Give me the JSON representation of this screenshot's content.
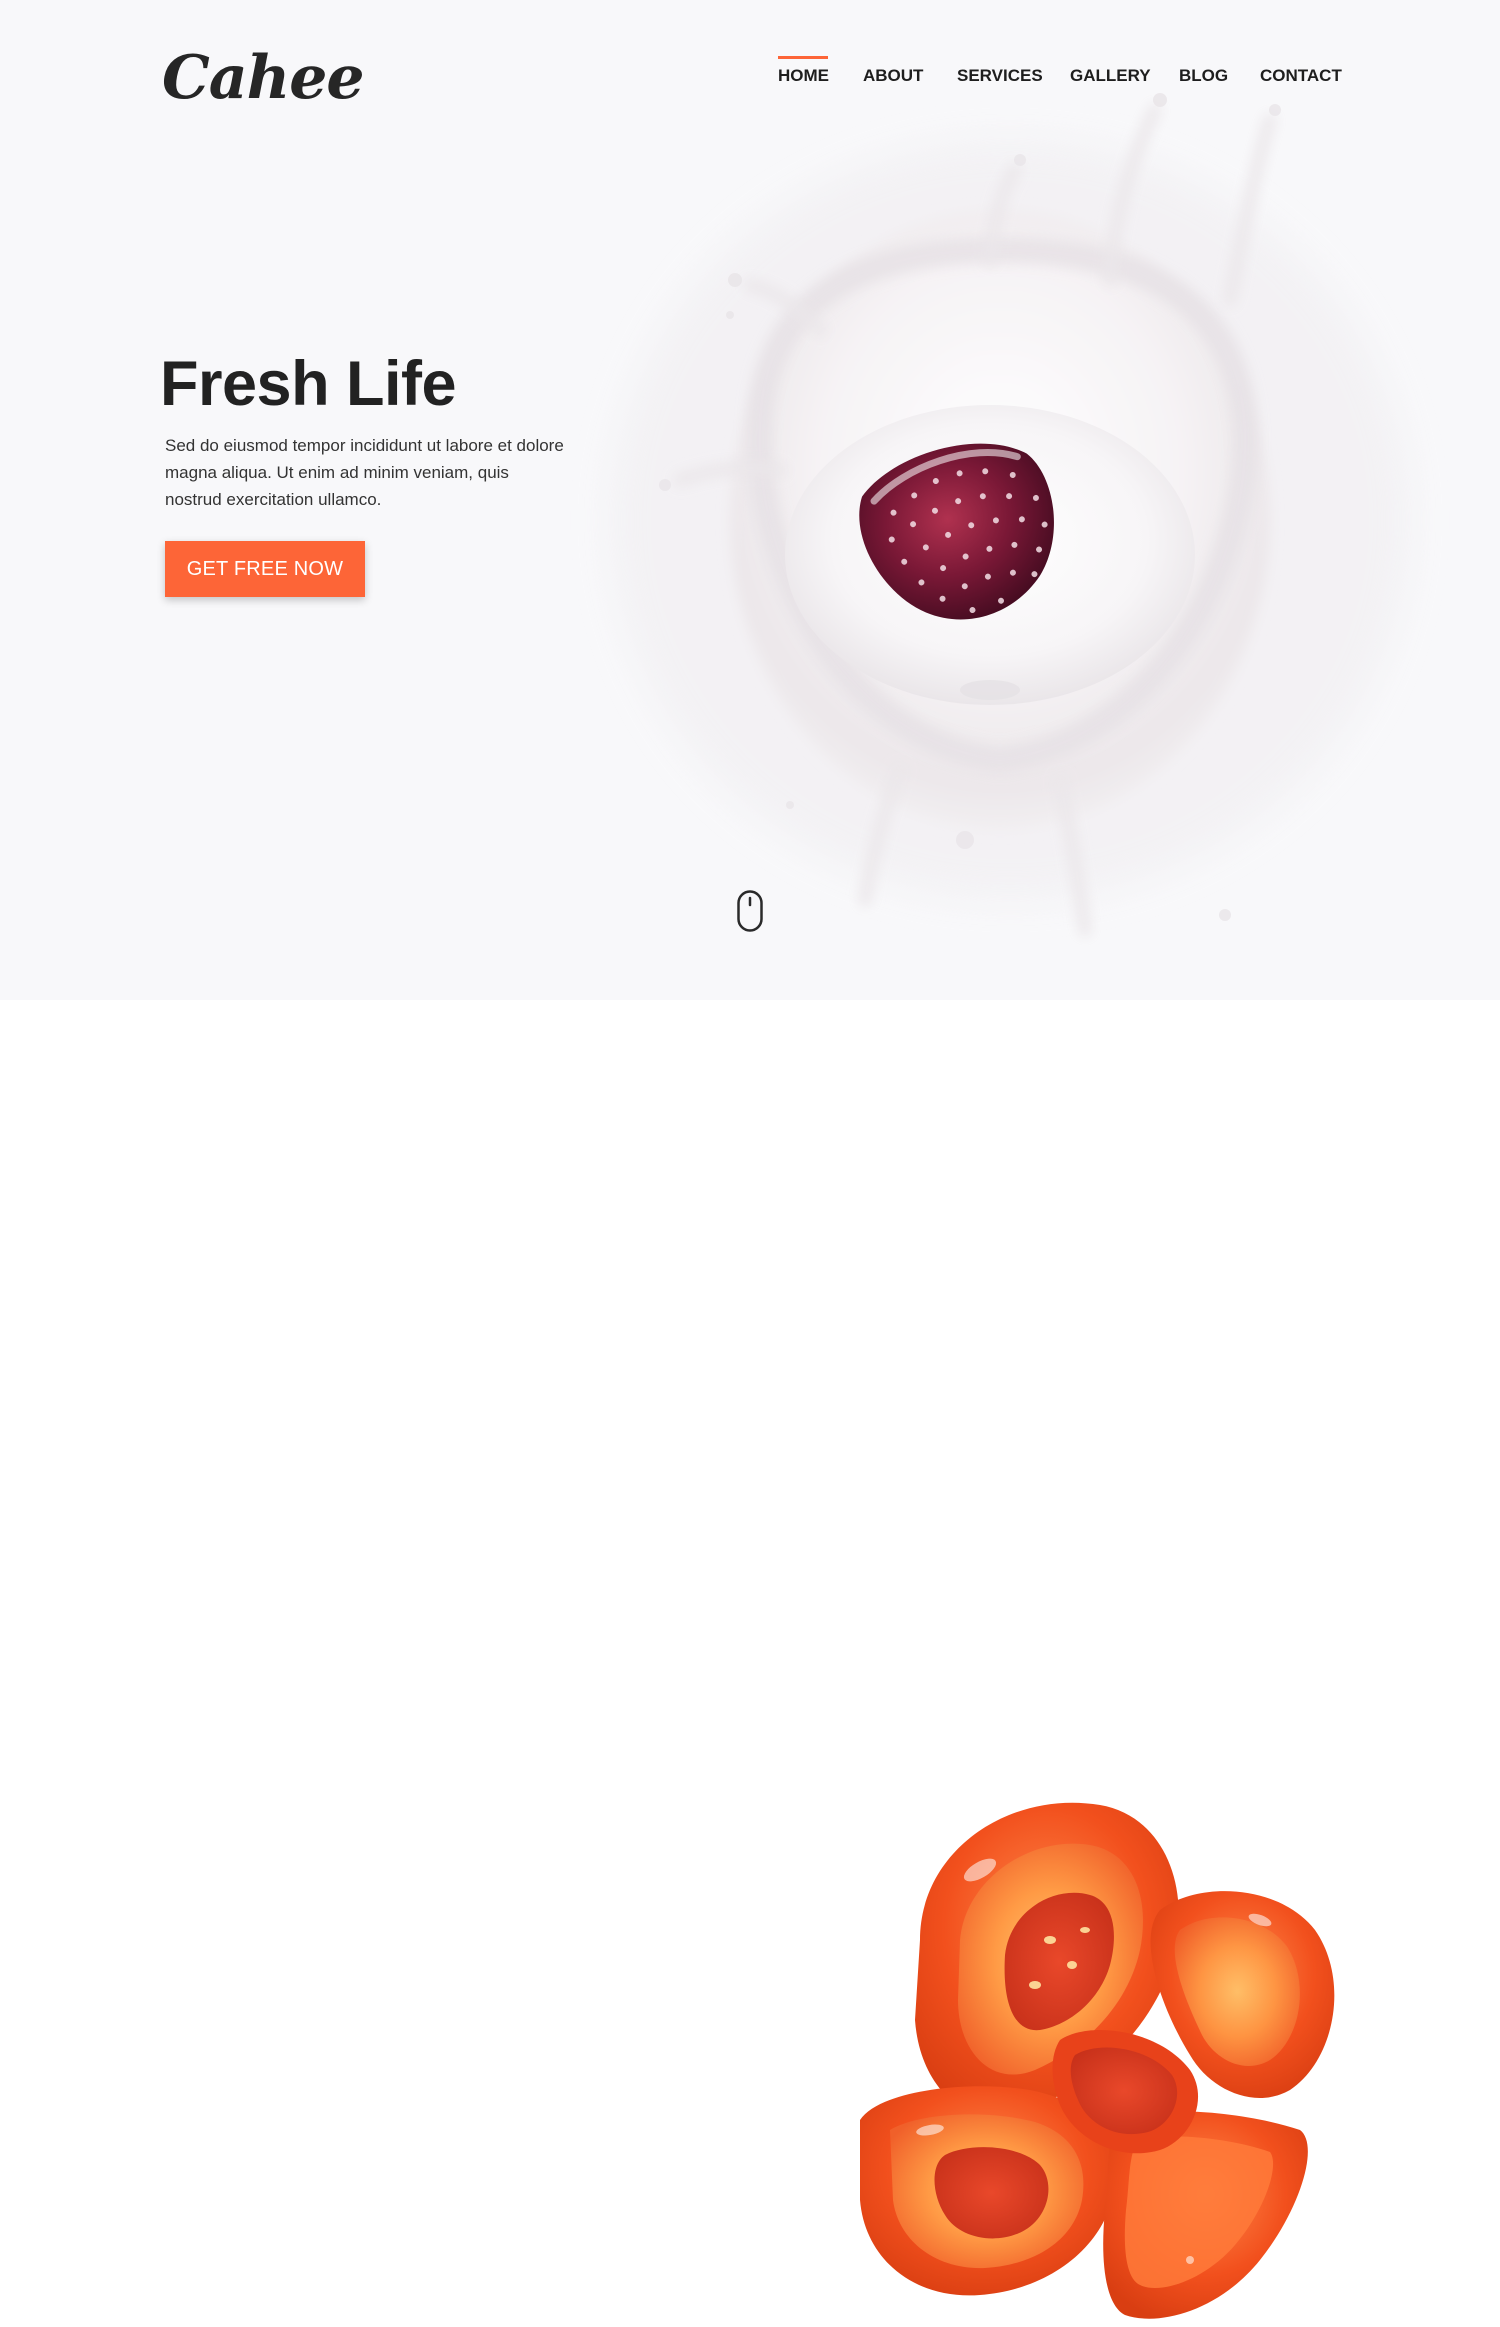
{
  "brand": {
    "logo_text": "Cahee"
  },
  "nav": {
    "items": [
      {
        "label": "HOME",
        "active": true
      },
      {
        "label": "ABOUT",
        "active": false
      },
      {
        "label": "SERVICES",
        "active": false
      },
      {
        "label": "GALLERY",
        "active": false
      },
      {
        "label": "BLOG",
        "active": false
      },
      {
        "label": "CONTACT",
        "active": false
      }
    ]
  },
  "hero": {
    "title": "Fresh Life",
    "text": "Sed do eiusmod tempor incididunt ut labore et dolore magna aliqua. Ut enim ad minim veniam, quis nostrud exercitation ullamco.",
    "cta_label": "GET FREE NOW",
    "image": "strawberry-milk-splash",
    "scroll_icon": "mouse-icon"
  },
  "section_two": {
    "image": "tomato-slices"
  },
  "colors": {
    "accent": "#fd6537",
    "text_dark": "#222222",
    "hero_bg": "#f8f8fa",
    "page_bg": "#ffffff"
  }
}
